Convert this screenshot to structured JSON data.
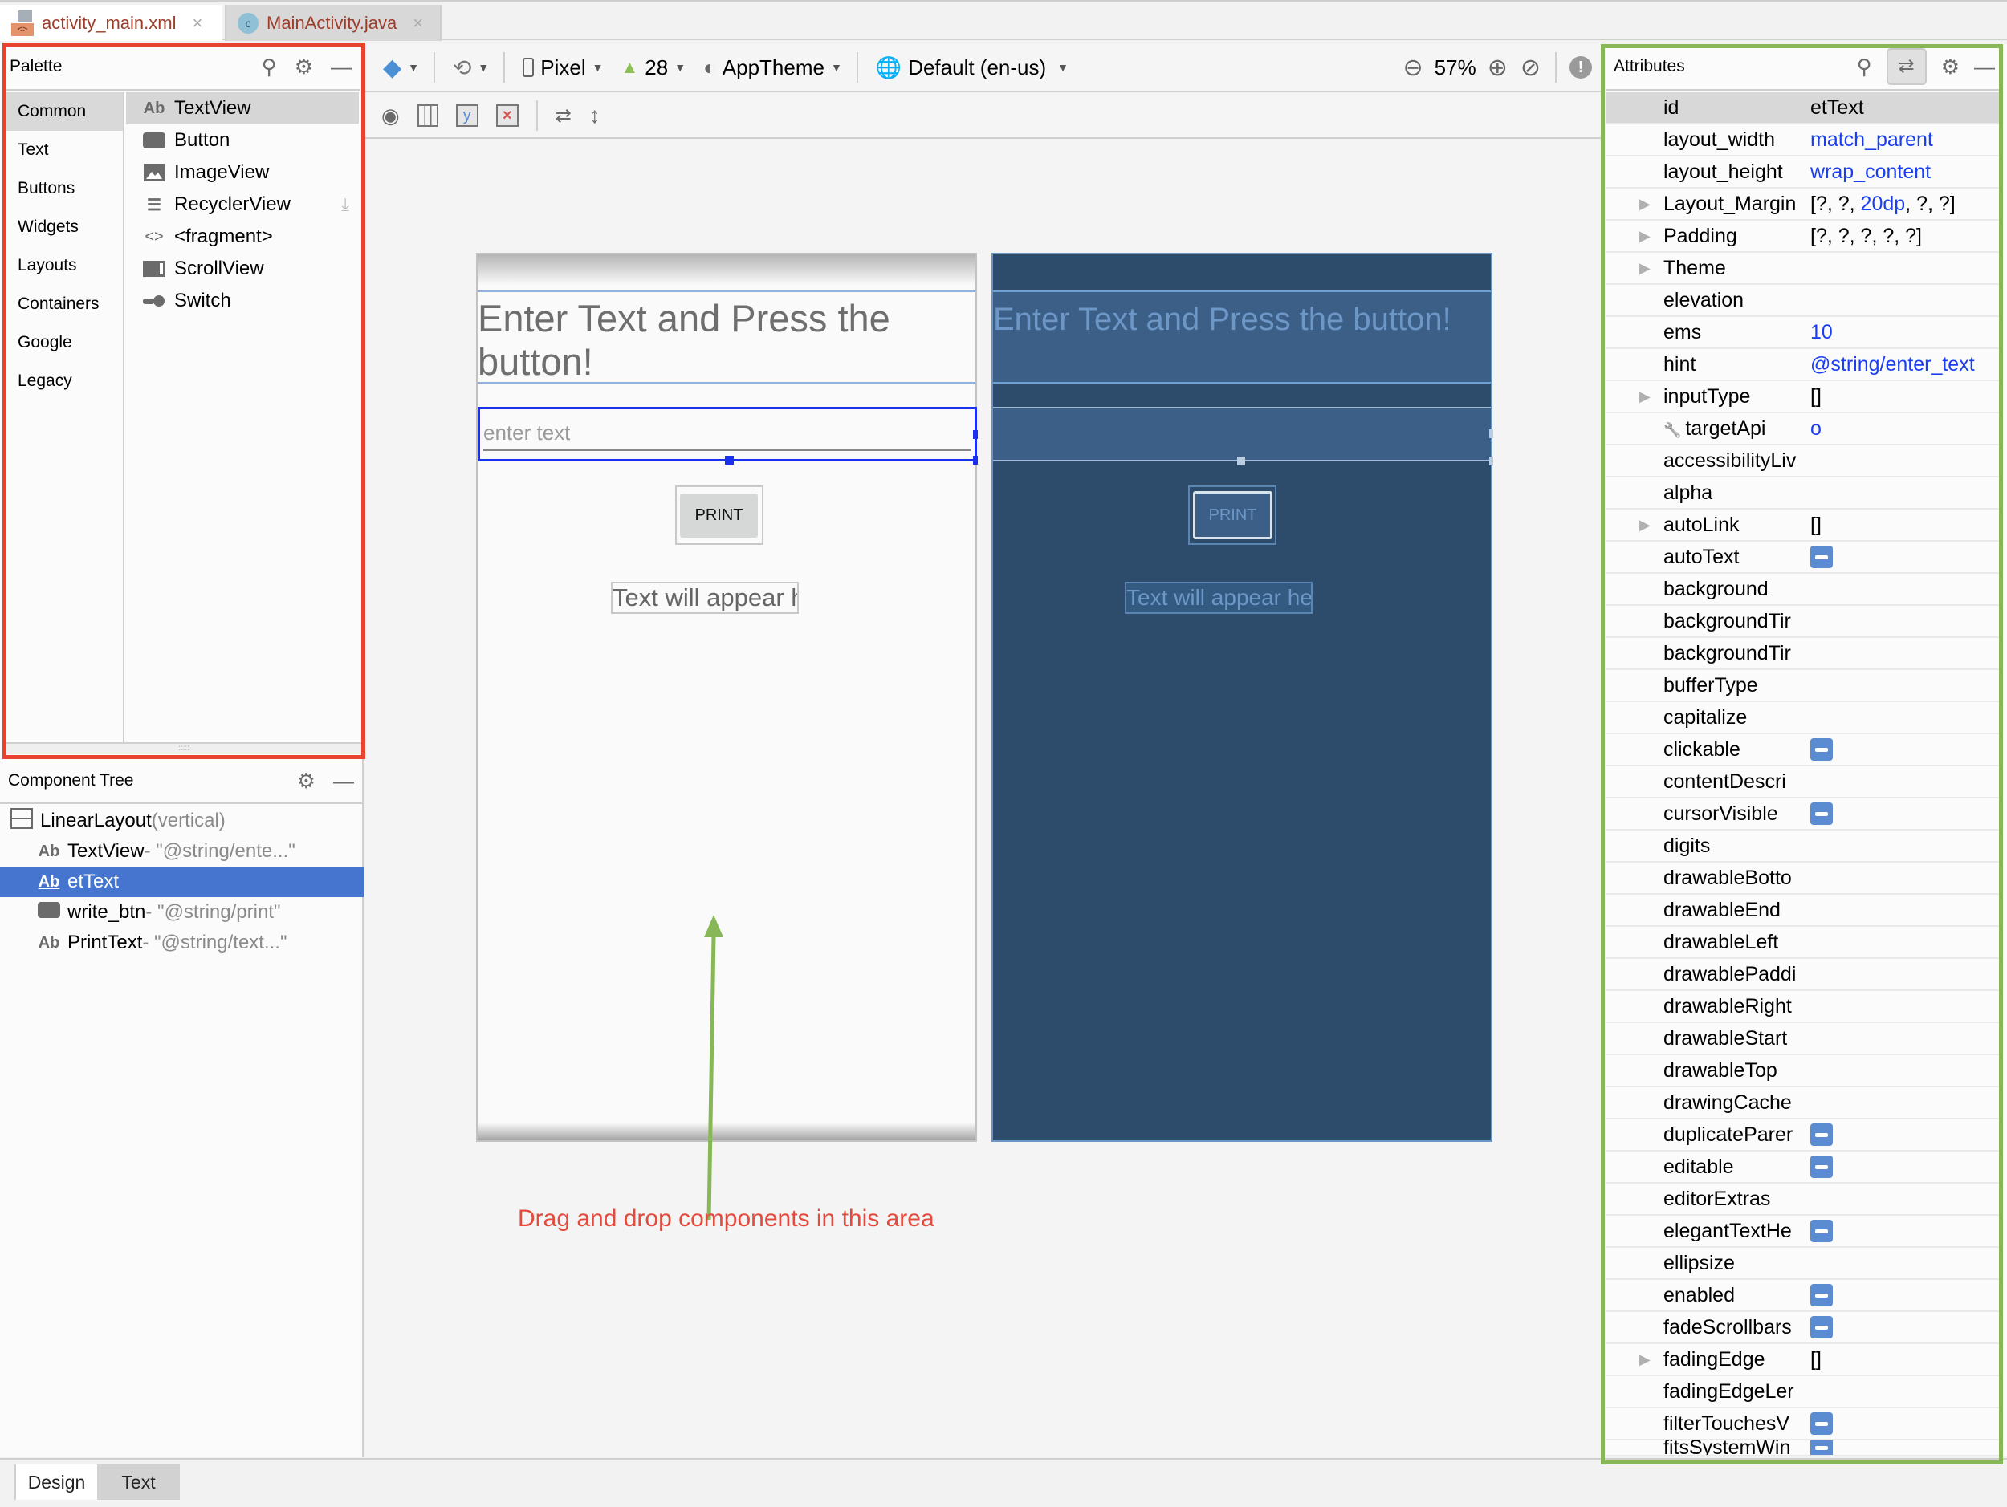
{
  "file_tabs": [
    {
      "label": "activity_main.xml",
      "icon": "xml-layout-icon",
      "active": true
    },
    {
      "label": "MainActivity.java",
      "icon": "java-class-icon",
      "active": false
    }
  ],
  "palette": {
    "title": "Palette",
    "categories": [
      "Common",
      "Text",
      "Buttons",
      "Widgets",
      "Layouts",
      "Containers",
      "Google",
      "Legacy"
    ],
    "selected_category": "Common",
    "items": [
      {
        "icon": "Ab",
        "label": "TextView"
      },
      {
        "icon": "button-icon",
        "label": "Button"
      },
      {
        "icon": "image-icon",
        "label": "ImageView"
      },
      {
        "icon": "list-icon",
        "label": "RecyclerView"
      },
      {
        "icon": "code-icon",
        "label": "<fragment>"
      },
      {
        "icon": "scroll-icon",
        "label": "ScrollView"
      },
      {
        "icon": "switch-icon",
        "label": "Switch"
      }
    ]
  },
  "component_tree": {
    "title": "Component Tree",
    "rows": [
      {
        "name": "LinearLayout",
        "detail": "(vertical)"
      },
      {
        "name": "TextView",
        "detail": "- \"@string/ente...\""
      },
      {
        "name": "etText",
        "detail": ""
      },
      {
        "name": "write_btn",
        "detail": "- \"@string/print\""
      },
      {
        "name": "PrintText",
        "detail": "- \"@string/text...\""
      }
    ],
    "selected": "etText"
  },
  "toolbar": {
    "device": "Pixel",
    "api_level": "28",
    "theme": "AppTheme",
    "locale": "Default (en-us)",
    "zoom": "57%"
  },
  "design_preview": {
    "title_text": "Enter Text and Press the button!",
    "edit_hint": "enter text",
    "button_label": "PRINT",
    "output_text": "Text will appear here!"
  },
  "annotation": {
    "text": "Drag and drop components in this area",
    "color": "#e24b3e",
    "arrow_color": "#88b758"
  },
  "attributes": {
    "title": "Attributes",
    "rows": [
      {
        "name": "id",
        "value": "etText",
        "style": "plain"
      },
      {
        "name": "layout_width",
        "value": "match_parent",
        "style": "blue"
      },
      {
        "name": "layout_height",
        "value": "wrap_content",
        "style": "blue"
      },
      {
        "name": "Layout_Margin",
        "value": "[?, ?, 20dp, ?, ?]",
        "style": "mixed",
        "expandable": true
      },
      {
        "name": "Padding",
        "value": "[?, ?, ?, ?, ?]",
        "style": "plain",
        "expandable": true
      },
      {
        "name": "Theme",
        "value": "",
        "expandable": true
      },
      {
        "name": "elevation",
        "value": ""
      },
      {
        "name": "ems",
        "value": "10",
        "style": "blue"
      },
      {
        "name": "hint",
        "value": "@string/enter_text",
        "style": "blue"
      },
      {
        "name": "inputType",
        "value": "[]",
        "style": "plain",
        "expandable": true
      },
      {
        "name": "targetApi",
        "value": "o",
        "style": "blue",
        "wrench": true
      },
      {
        "name": "accessibilityLiv",
        "value": ""
      },
      {
        "name": "alpha",
        "value": ""
      },
      {
        "name": "autoLink",
        "value": "[]",
        "style": "plain",
        "expandable": true
      },
      {
        "name": "autoText",
        "checkbox": true
      },
      {
        "name": "background",
        "value": ""
      },
      {
        "name": "backgroundTir",
        "value": ""
      },
      {
        "name": "backgroundTir",
        "value": ""
      },
      {
        "name": "bufferType",
        "value": ""
      },
      {
        "name": "capitalize",
        "value": ""
      },
      {
        "name": "clickable",
        "checkbox": true
      },
      {
        "name": "contentDescri",
        "value": ""
      },
      {
        "name": "cursorVisible",
        "checkbox": true
      },
      {
        "name": "digits",
        "value": ""
      },
      {
        "name": "drawableBotto",
        "value": ""
      },
      {
        "name": "drawableEnd",
        "value": ""
      },
      {
        "name": "drawableLeft",
        "value": ""
      },
      {
        "name": "drawablePaddi",
        "value": ""
      },
      {
        "name": "drawableRight",
        "value": ""
      },
      {
        "name": "drawableStart",
        "value": ""
      },
      {
        "name": "drawableTop",
        "value": ""
      },
      {
        "name": "drawingCache",
        "value": ""
      },
      {
        "name": "duplicateParer",
        "checkbox": true
      },
      {
        "name": "editable",
        "checkbox": true
      },
      {
        "name": "editorExtras",
        "value": ""
      },
      {
        "name": "elegantTextHe",
        "checkbox": true
      },
      {
        "name": "ellipsize",
        "value": ""
      },
      {
        "name": "enabled",
        "checkbox": true
      },
      {
        "name": "fadeScrollbars",
        "checkbox": true
      },
      {
        "name": "fadingEdge",
        "value": "[]",
        "style": "plain",
        "expandable": true
      },
      {
        "name": "fadingEdgeLer",
        "value": ""
      },
      {
        "name": "filterTouchesV",
        "checkbox": true
      },
      {
        "name": "fitsSystemWin",
        "checkbox": true
      }
    ]
  },
  "bottom_tabs": [
    {
      "label": "Design",
      "active": true
    },
    {
      "label": "Text",
      "active": false
    }
  ],
  "colors": {
    "palette_highlight": "#e8432f",
    "attributes_highlight": "#88b758",
    "selection_blue": "#4675cf"
  }
}
